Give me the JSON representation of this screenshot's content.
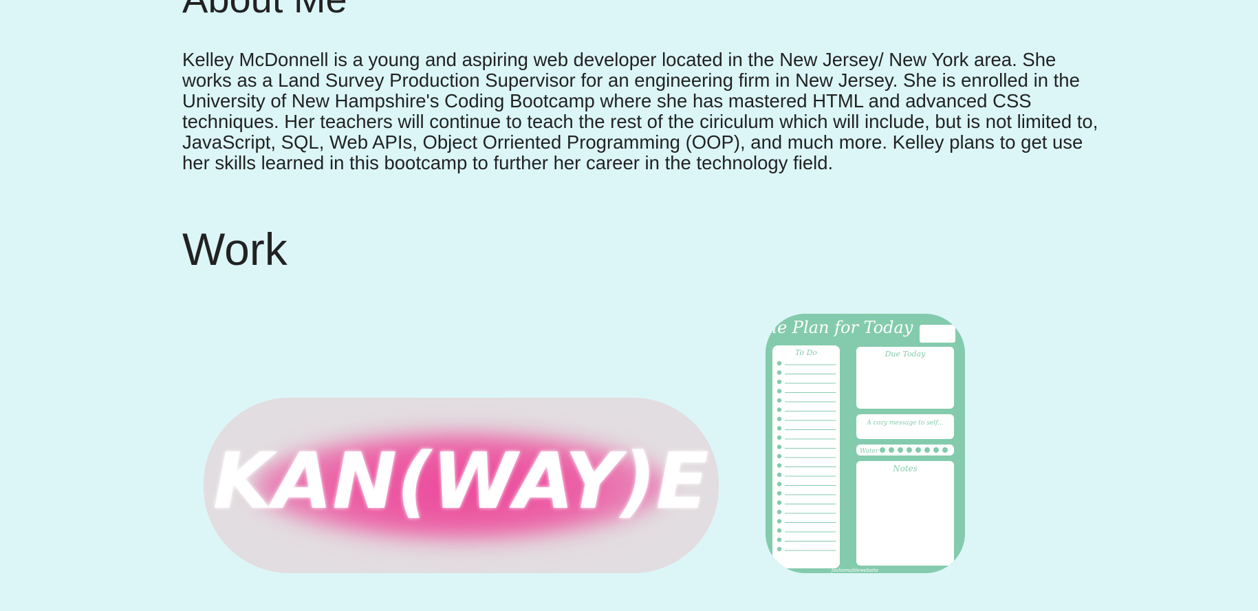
{
  "about": {
    "heading": "About Me",
    "body": "Kelley McDonnell is a young and aspiring web developer located in the New Jersey/ New York area. She works as a Land Survey Production Supervisor for an engineering firm in New Jersey. She is enrolled in the University of New Hampshire's Coding Bootcamp where she has mastered HTML and advanced CSS techniques. Her teachers will continue to teach the rest of the ciriculum which will include, but is not limited to, JavaScript, SQL, Web APIs, Object Orriented Programming (OOP), and much more. Kelley plans to get use her skills learned in this bootcamp to further her career in the technology field."
  },
  "work": {
    "heading": "Work",
    "projects": [
      {
        "logo_text": "KAN(WAY)E",
        "colors": {
          "glow": "#ea3f95",
          "background": "#e2dde0",
          "letters": "#ffffff"
        }
      },
      {
        "planner_title": "The Plan for Today",
        "todo_label": "To Do",
        "due_label": "Due Today",
        "message_label": "A cozy message to self...",
        "water_label": "Water",
        "notes_label": "Notes",
        "footer_text": "fashionablewebsite",
        "colors": {
          "background": "#83cbac",
          "panel": "#ffffff"
        }
      }
    ]
  },
  "colors": {
    "page_background": "#dcf6f8",
    "text": "#222222"
  }
}
